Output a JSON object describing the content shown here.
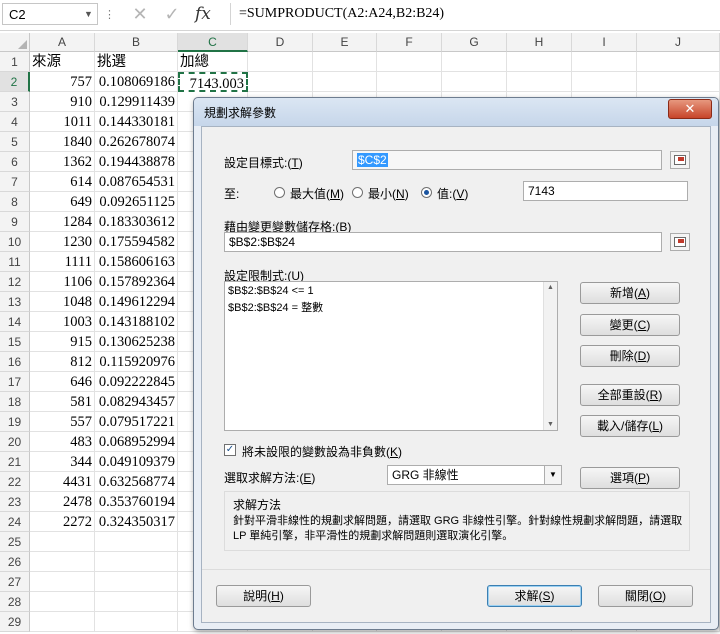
{
  "namebox": {
    "value": "C2"
  },
  "formula_bar": {
    "fx": "fx",
    "cancel_icon": "✕",
    "enter_icon": "✓",
    "value": "=SUMPRODUCT(A2:A24,B2:B24)"
  },
  "columns": [
    "A",
    "B",
    "C",
    "D",
    "E",
    "F",
    "G",
    "H",
    "I",
    "J"
  ],
  "header_row": {
    "a": "來源",
    "b": "挑選",
    "c": "加總"
  },
  "rows": [
    {
      "n": "1"
    },
    {
      "n": "2",
      "a": "757",
      "b": "0.108069186",
      "c": "7143.003"
    },
    {
      "n": "3",
      "a": "910",
      "b": "0.129911439"
    },
    {
      "n": "4",
      "a": "1011",
      "b": "0.144330181"
    },
    {
      "n": "5",
      "a": "1840",
      "b": "0.262678074"
    },
    {
      "n": "6",
      "a": "1362",
      "b": "0.194438878"
    },
    {
      "n": "7",
      "a": "614",
      "b": "0.087654531"
    },
    {
      "n": "8",
      "a": "649",
      "b": "0.092651125"
    },
    {
      "n": "9",
      "a": "1284",
      "b": "0.183303612"
    },
    {
      "n": "10",
      "a": "1230",
      "b": "0.175594582"
    },
    {
      "n": "11",
      "a": "1111",
      "b": "0.158606163"
    },
    {
      "n": "12",
      "a": "1106",
      "b": "0.157892364"
    },
    {
      "n": "13",
      "a": "1048",
      "b": "0.149612294"
    },
    {
      "n": "14",
      "a": "1003",
      "b": "0.143188102"
    },
    {
      "n": "15",
      "a": "915",
      "b": "0.130625238"
    },
    {
      "n": "16",
      "a": "812",
      "b": "0.115920976"
    },
    {
      "n": "17",
      "a": "646",
      "b": "0.092222845"
    },
    {
      "n": "18",
      "a": "581",
      "b": "0.082943457"
    },
    {
      "n": "19",
      "a": "557",
      "b": "0.079517221"
    },
    {
      "n": "20",
      "a": "483",
      "b": "0.068952994"
    },
    {
      "n": "21",
      "a": "344",
      "b": "0.049109379"
    },
    {
      "n": "22",
      "a": "4431",
      "b": "0.632568774"
    },
    {
      "n": "23",
      "a": "2478",
      "b": "0.353760194"
    },
    {
      "n": "24",
      "a": "2272",
      "b": "0.324350317"
    },
    {
      "n": "25"
    },
    {
      "n": "26"
    },
    {
      "n": "27"
    },
    {
      "n": "28"
    },
    {
      "n": "29"
    }
  ],
  "solver": {
    "title": "規劃求解參數",
    "close": "✕",
    "objective_label": "設定目標式:",
    "objective_key": "T",
    "objective_value": "$C$2",
    "to_label": "至:",
    "opt_max": "最大值",
    "opt_max_key": "M",
    "opt_min": "最小",
    "opt_min_key": "N",
    "opt_value": "值:",
    "opt_value_key": "V",
    "target_value": "7143",
    "changing_label": "藉由變更變數儲存格:",
    "changing_key": "B",
    "changing_value": "$B$2:$B$24",
    "constraints_label": "設定限制式:",
    "constraints_key": "U",
    "constraints": [
      "$B$2:$B$24 <= 1",
      "$B$2:$B$24 = 整數"
    ],
    "btn_add": "新增",
    "btn_add_key": "A",
    "btn_change": "變更",
    "btn_change_key": "C",
    "btn_delete": "刪除",
    "btn_delete_key": "D",
    "btn_reset": "全部重設",
    "btn_reset_key": "R",
    "btn_load": "載入/儲存",
    "btn_load_key": "L",
    "nonneg_label": "將未設限的變數設為非負數",
    "nonneg_key": "K",
    "method_label": "選取求解方法:",
    "method_key": "E",
    "method_value": "GRG 非線性",
    "btn_options": "選項",
    "btn_options_key": "P",
    "group_title": "求解方法",
    "group_desc": "針對平滑非線性的規劃求解問題，請選取 GRG 非線性引擎。針對線性規劃求解問題，請選取 LP 單純引擎，非平滑性的規劃求解問題則選取演化引擎。",
    "btn_help": "說明",
    "btn_help_key": "H",
    "btn_solve": "求解",
    "btn_solve_key": "S",
    "btn_close": "關閉",
    "btn_close_key": "O"
  }
}
